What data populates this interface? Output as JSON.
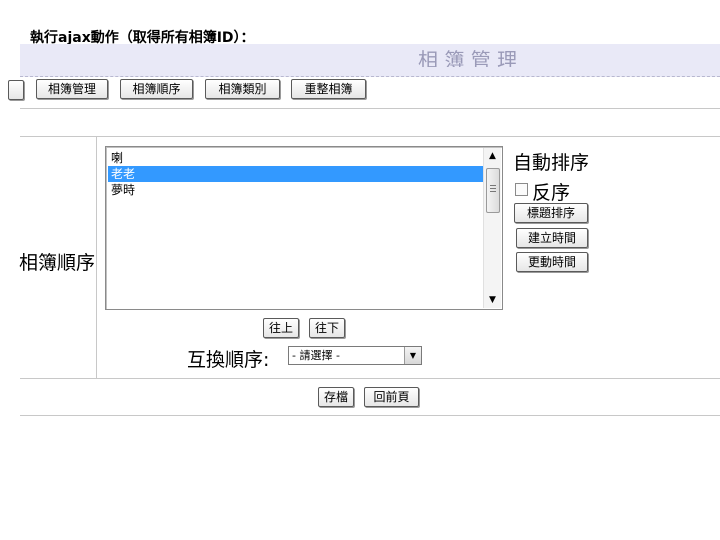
{
  "caption": "執行ajax動作（取得所有相簿ID）：",
  "header": {
    "title_fragment": "相 簿 管 理"
  },
  "toolbar": {
    "buttons": [
      "相簿管理",
      "相簿順序",
      "相簿類別",
      "重整相簿"
    ]
  },
  "form": {
    "row_label": "相簿順序",
    "list": {
      "items": [
        "喇",
        "老老",
        "夢時"
      ],
      "selected_index": 1
    },
    "auto_sort_label": "自動排序",
    "reverse_label": "反序",
    "reverse_checked": false,
    "sort_buttons": [
      "標題排序",
      "建立時間",
      "更動時間"
    ],
    "move_buttons": [
      "往上",
      "往下"
    ],
    "swap_label": "互換順序:",
    "swap_select_value": "- 請選擇 -"
  },
  "footer": {
    "save_label": "存檔",
    "back_label": "回前頁"
  }
}
